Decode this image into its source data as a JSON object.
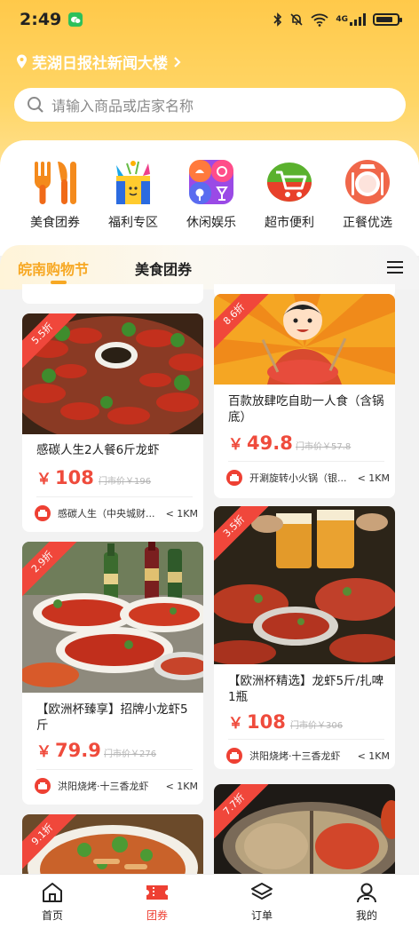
{
  "status_bar": {
    "time": "2:49",
    "network": "4G",
    "battery_level": 0.8
  },
  "header": {
    "location": "芜湖日报社新闻大楼",
    "search_placeholder": "请输入商品或店家名称"
  },
  "categories": [
    {
      "label": "美食团券",
      "icon": "fork-knife-icon"
    },
    {
      "label": "福利专区",
      "icon": "gift-box-icon"
    },
    {
      "label": "休闲娱乐",
      "icon": "entertainment-icon"
    },
    {
      "label": "超市便利",
      "icon": "shopping-cart-icon"
    },
    {
      "label": "正餐优选",
      "icon": "dinner-plate-icon"
    }
  ],
  "tabs": {
    "active": "皖南购物节",
    "second": "美食团券"
  },
  "cards": {
    "c1": {
      "discount": "5.5折",
      "title": "感碳人生2人餐6斤龙虾",
      "price": "108",
      "old_price": "门市价￥196",
      "store": "感碳人生（中央城财...",
      "distance": "< 1KM"
    },
    "c2": {
      "discount": "8.6折",
      "title": "百款放肆吃自助一人食（含锅底）",
      "price": "49.8",
      "old_price": "门市价￥57.8",
      "store": "开涮旋转小火锅（银...",
      "distance": "< 1KM"
    },
    "c3": {
      "discount": "2.9折",
      "title": "【欧洲杯臻享】招牌小龙虾5斤",
      "price": "79.9",
      "old_price": "门市价￥276",
      "store": "洪阳烧烤·十三香龙虾",
      "distance": "< 1KM"
    },
    "c4": {
      "discount": "3.5折",
      "title": "【欧洲杯精选】龙虾5斤/扎啤1瓶",
      "price": "108",
      "old_price": "门市价￥306",
      "store": "洪阳烧烤·十三香龙虾",
      "distance": "< 1KM"
    },
    "c5": {
      "discount": "9.1折"
    },
    "c6": {
      "discount": "7.7折"
    }
  },
  "currency_symbol": "￥",
  "bottom_nav": [
    {
      "label": "首页",
      "icon": "home-icon"
    },
    {
      "label": "团券",
      "icon": "ticket-icon"
    },
    {
      "label": "订单",
      "icon": "layers-icon"
    },
    {
      "label": "我的",
      "icon": "user-icon"
    }
  ],
  "colors": {
    "accent": "#f7a823",
    "price": "#ef4b3c",
    "active_nav": "#ee4033",
    "header": "#ffcf55"
  }
}
